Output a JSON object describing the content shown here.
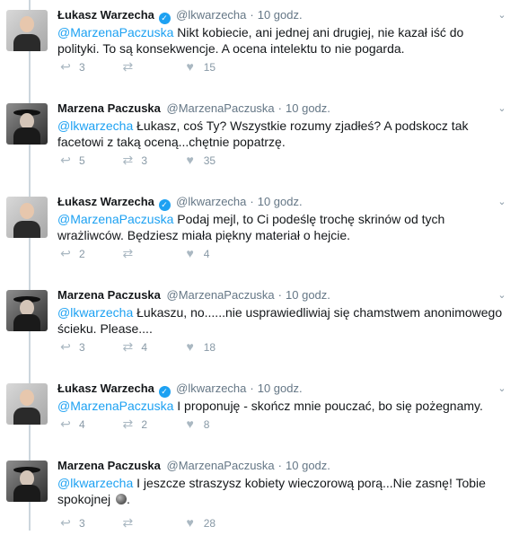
{
  "tweets": [
    {
      "author": "Łukasz Warzecha",
      "verified": true,
      "handle": "@lkwarzecha",
      "time": "10 godz.",
      "mention": "@MarzenaPaczuska",
      "text": " Nikt kobiecie, ani jednej ani drugiej, nie kazał iść do polityki. To są konsekwencje. A ocena intelektu to nie pogarda.",
      "replies": "3",
      "retweets": "",
      "likes": "15"
    },
    {
      "author": "Marzena Paczuska",
      "verified": false,
      "handle": "@MarzenaPaczuska",
      "time": "10 godz.",
      "mention": "@lkwarzecha",
      "text": " Łukasz, coś Ty? Wszystkie rozumy zjadłeś? A podskocz tak facetowi z taką oceną...chętnie popatrzę.",
      "replies": "5",
      "retweets": "3",
      "likes": "35"
    },
    {
      "author": "Łukasz Warzecha",
      "verified": true,
      "handle": "@lkwarzecha",
      "time": "10 godz.",
      "mention": "@MarzenaPaczuska",
      "text": " Podaj mejl, to Ci podeślę trochę skrinów od tych wrażliwców. Będziesz miała piękny materiał o hejcie.",
      "replies": "2",
      "retweets": "",
      "likes": "4"
    },
    {
      "author": "Marzena Paczuska",
      "verified": false,
      "handle": "@MarzenaPaczuska",
      "time": "10 godz.",
      "mention": "@lkwarzecha",
      "text": " Łukaszu, no......nie usprawiedliwiaj się chamstwem anonimowego ścieku. Please....",
      "replies": "3",
      "retweets": "4",
      "likes": "18"
    },
    {
      "author": "Łukasz Warzecha",
      "verified": true,
      "handle": "@lkwarzecha",
      "time": "10 godz.",
      "mention": "@MarzenaPaczuska",
      "text": " I proponuję - skończ mnie pouczać, bo się pożegnamy.",
      "replies": "4",
      "retweets": "2",
      "likes": "8"
    },
    {
      "author": "Marzena Paczuska",
      "verified": false,
      "handle": "@MarzenaPaczuska",
      "time": "10 godz.",
      "mention": "@lkwarzecha",
      "text": " I jeszcze straszysz kobiety wieczorową porą...Nie zasnę! Tobie spokojnej",
      "emoji": "moon",
      "replies": "3",
      "retweets": "",
      "likes": "28"
    }
  ],
  "icons": {
    "reply": "reply-icon",
    "retweet": "retweet-icon",
    "like": "heart-icon",
    "more": "chevron-down-icon",
    "verified": "verified-icon"
  },
  "colors": {
    "link": "#1da1f2",
    "meta": "#657786",
    "action": "#aab8c2",
    "thread_line": "#ccd6dd"
  }
}
